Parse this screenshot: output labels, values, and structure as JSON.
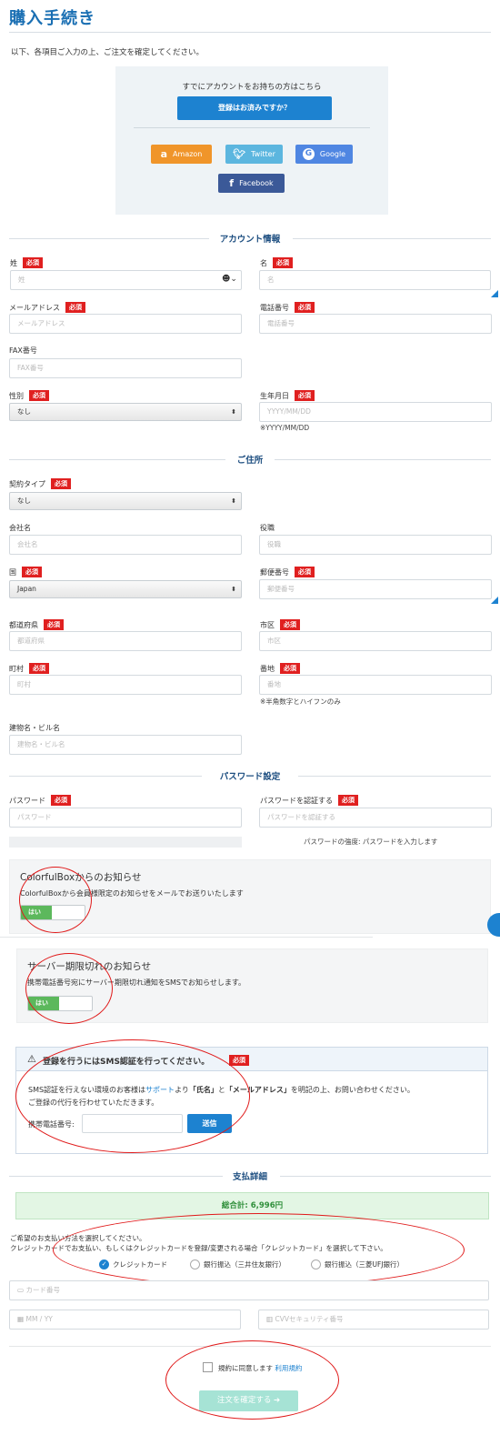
{
  "header": {
    "title": "購入手続き",
    "intro": "以下、各項目ご入力の上、ご注文を確定してください。"
  },
  "login": {
    "note": "すでにアカウントをお持ちの方はこちら",
    "login_button": "登録はお済みですか？",
    "amazon": "Amazon",
    "twitter": "Twitter",
    "google": "Google",
    "facebook": "Facebook"
  },
  "required_label": "必須",
  "account": {
    "section_title": "アカウント情報",
    "last_name_label": "姓",
    "last_name_placeholder": "姓",
    "first_name_label": "名",
    "first_name_placeholder": "名",
    "email_label": "メールアドレス",
    "email_placeholder": "メールアドレス",
    "phone_label": "電話番号",
    "phone_placeholder": "電話番号",
    "fax_label": "FAX番号",
    "fax_placeholder": "FAX番号",
    "gender_label": "性別",
    "gender_value": "なし",
    "birthday_label": "生年月日",
    "birthday_placeholder": "YYYY/MM/DD",
    "birthday_hint": "※YYYY/MM/DD"
  },
  "address": {
    "section_title": "ご住所",
    "contract_label": "契約タイプ",
    "contract_value": "なし",
    "company_label": "会社名",
    "company_placeholder": "会社名",
    "position_label": "役職",
    "position_placeholder": "役職",
    "country_label": "国",
    "country_value": "Japan",
    "postal_label": "郵便番号",
    "postal_placeholder": "郵便番号",
    "prefecture_label": "都道府県",
    "prefecture_placeholder": "都道府県",
    "city_label": "市区",
    "city_placeholder": "市区",
    "town_label": "町村",
    "town_placeholder": "町村",
    "street_label": "番地",
    "street_placeholder": "番地",
    "street_hint": "※半角数字とハイフンのみ",
    "building_label": "建物名・ビル名",
    "building_placeholder": "建物名・ビル名"
  },
  "password": {
    "section_title": "パスワード設定",
    "password_label": "パスワード",
    "password_placeholder": "パスワード",
    "confirm_label": "パスワードを認証する",
    "confirm_placeholder": "パスワードを認証する",
    "strength_text": "パスワードの強度: パスワードを入力します"
  },
  "colorful_notice": {
    "title": "ColorfulBoxからのお知らせ",
    "text": "ColorfulBoxから会員様限定のお知らせをメールでお送りいたします",
    "toggle_label": "はい"
  },
  "server_notice": {
    "title": "サーバー期限切れのお知らせ",
    "text": "携帯電話番号宛にサーバー期限切れ通知をSMSでお知らせします。",
    "toggle_label": "はい"
  },
  "sms": {
    "title": "登録を行うにはSMS認証を行ってください。",
    "text_pre": "SMS認証を行えない環境のお客様は",
    "support_link": "サポート",
    "text_mid1": "より",
    "name_quote": "「氏名」",
    "text_and": "と",
    "email_quote": "「メールアドレス」",
    "text_post": "を明記の上、お問い合わせください。",
    "text_line2": "ご登録の代行を行わせていただきます。",
    "phone_label": "携帯電話番号:",
    "send_button": "送信"
  },
  "payment": {
    "section_title": "支払詳細",
    "total_label": "総合計:",
    "total_value": "6,996円",
    "instruction1": "ご希望のお支払い方法を選択してください。",
    "instruction2": "クレジットカードでお支払い、もしくはクレジットカードを登録/変更される場合「クレジットカード」を選択して下さい。",
    "method_credit": "クレジットカード",
    "method_smbc": "銀行振込（三井住友銀行）",
    "method_mufg": "銀行振込（三菱UFJ銀行）",
    "card_number_placeholder": "カード番号",
    "expiry_placeholder": "MM / YY",
    "cvv_placeholder": "CVVセキュリティ番号"
  },
  "terms": {
    "agree_text": "規約に同意します",
    "terms_link": "利用規約",
    "submit_button": "注文を確定する"
  },
  "colors": {
    "accent": "#1d82d0",
    "required": "#e02020",
    "success": "#5cb85c",
    "annotation": "#e01a1a"
  }
}
